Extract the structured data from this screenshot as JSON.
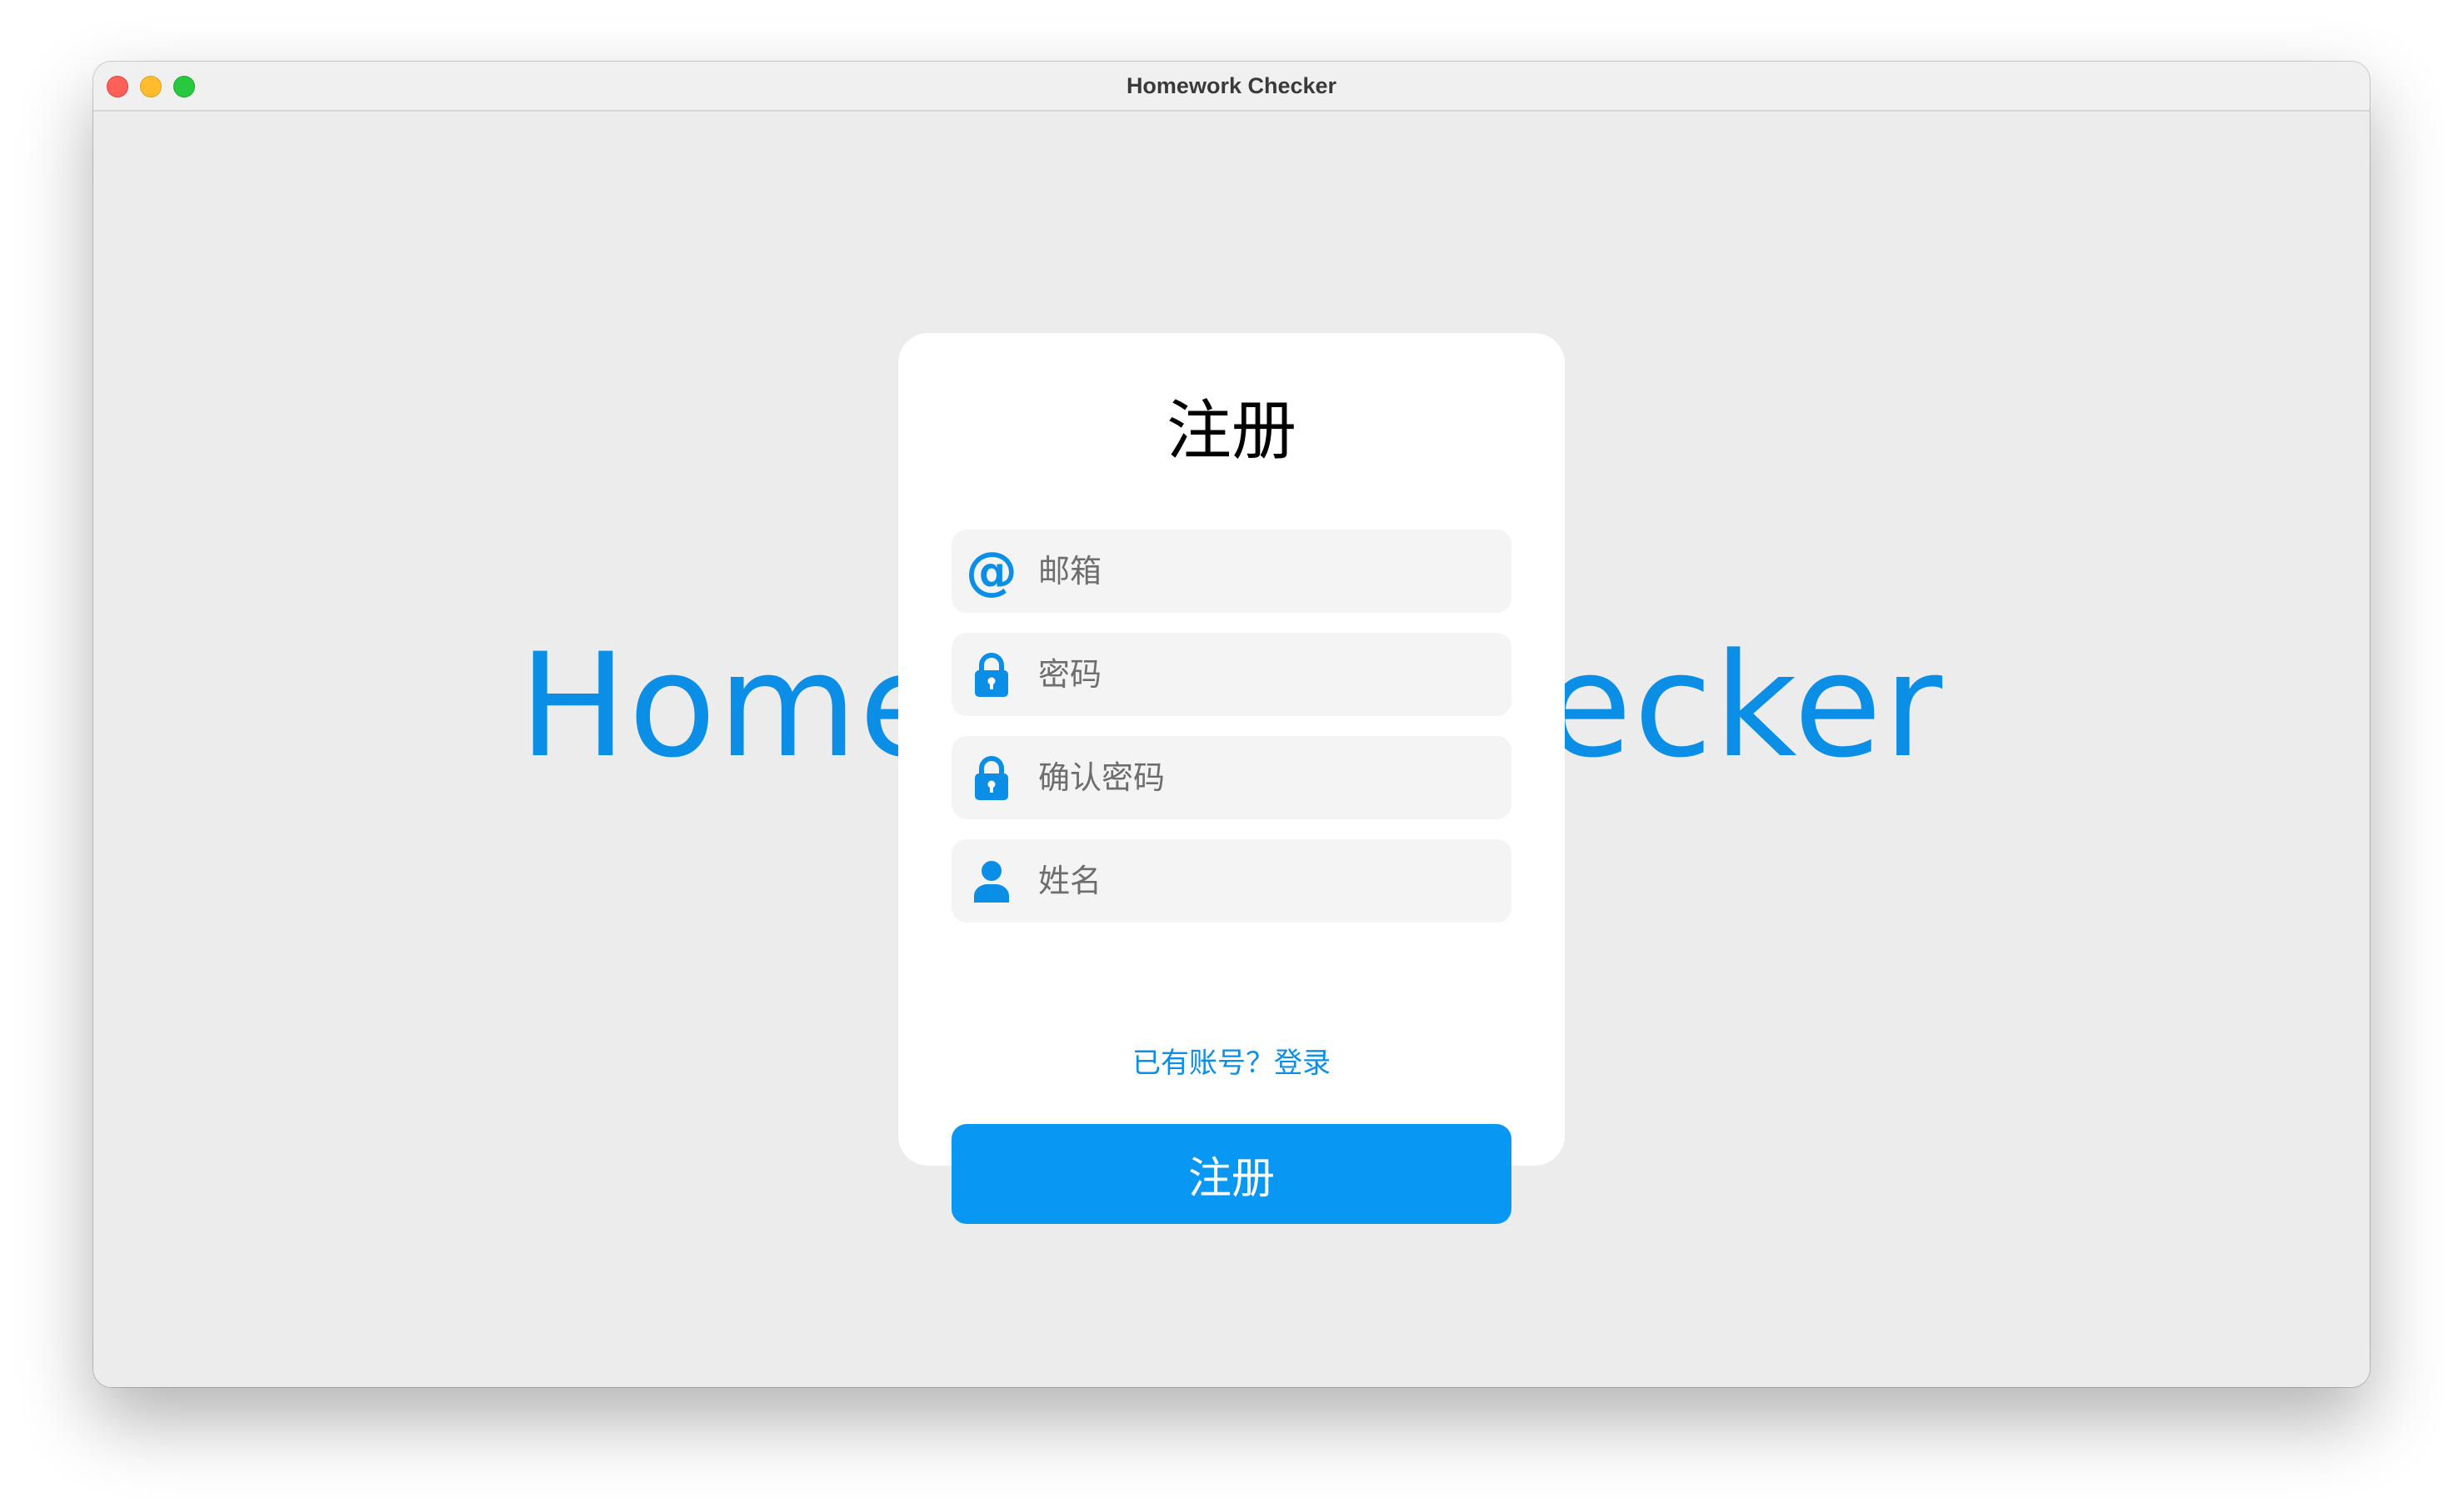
{
  "window": {
    "title": "Homework Checker"
  },
  "background_heading": "Homework Checker",
  "register_card": {
    "title": "注册",
    "fields": [
      {
        "icon": "at-icon",
        "placeholder": "邮箱",
        "value": ""
      },
      {
        "icon": "lock-icon",
        "placeholder": "密码",
        "value": ""
      },
      {
        "icon": "lock-icon",
        "placeholder": "确认密码",
        "value": ""
      },
      {
        "icon": "person-icon",
        "placeholder": "姓名",
        "value": ""
      }
    ],
    "login_link": "已有账号？登录",
    "submit_label": "注册"
  },
  "colors": {
    "accent": "#0A8EE6",
    "button": "#0898F3",
    "window_background": "#ECECEC",
    "field_background": "#F4F4F4"
  },
  "icons": {
    "at_glyph": "@"
  }
}
